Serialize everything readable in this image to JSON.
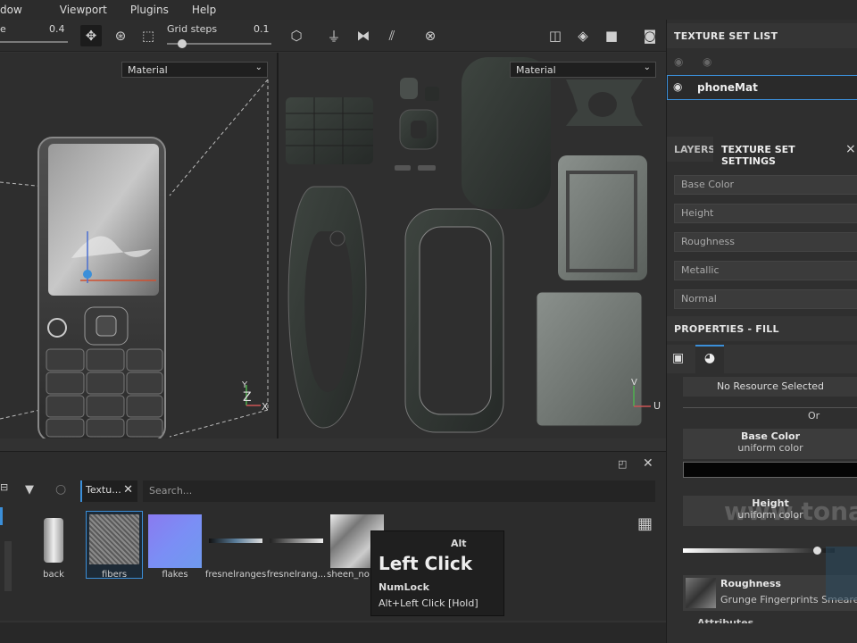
{
  "menu": {
    "items": [
      "dow",
      "Viewport",
      "Plugins",
      "Help"
    ]
  },
  "toolbar": {
    "size_label": "e",
    "size_value": "0.4",
    "grid_label": "Grid steps",
    "grid_value": "0.1"
  },
  "viewport3d": {
    "material_select": "Material",
    "axes": {
      "y": "Y",
      "z": "Z",
      "x": "X"
    }
  },
  "viewport2d": {
    "material_select": "Material",
    "axes": {
      "v": "V",
      "u": "U"
    }
  },
  "texture_set_list": {
    "title": "TEXTURE SET LIST",
    "items": [
      {
        "label": "phoneMat"
      }
    ]
  },
  "tabs": {
    "layers": "LAYERS",
    "tss": "TEXTURE SET SETTINGS",
    "close": "×"
  },
  "channels": [
    "Base Color",
    "Height",
    "Roughness",
    "Metallic",
    "Normal"
  ],
  "properties": {
    "title": "PROPERTIES - FILL",
    "no_resource": "No Resource Selected",
    "or": "Or",
    "base_color": {
      "title": "Base Color",
      "sub": "uniform color",
      "color": "#050505"
    },
    "height": {
      "title": "Height",
      "sub": "uniform color",
      "slider_value": 0.88
    },
    "roughness": {
      "title": "Roughness",
      "sub": "Grunge Fingerprints Smeared"
    },
    "attributes": "Attributes"
  },
  "shelf": {
    "tab_label": "Textu...",
    "search_placeholder": "Search...",
    "items": [
      {
        "label": "back"
      },
      {
        "label": "fibers"
      },
      {
        "label": "flakes"
      },
      {
        "label": "fresnelranges"
      },
      {
        "label": "fresnelrang..."
      },
      {
        "label": "sheen_no"
      }
    ]
  },
  "tooltip": {
    "modifier": "Alt",
    "action": "Left Click",
    "key": "NumLock",
    "hint": "Alt+Left Click [Hold]"
  },
  "watermark": {
    "text": "www.tona"
  },
  "colors": {
    "accent": "#3b8fd9",
    "panel": "#2f2f2f",
    "header": "#353535"
  }
}
